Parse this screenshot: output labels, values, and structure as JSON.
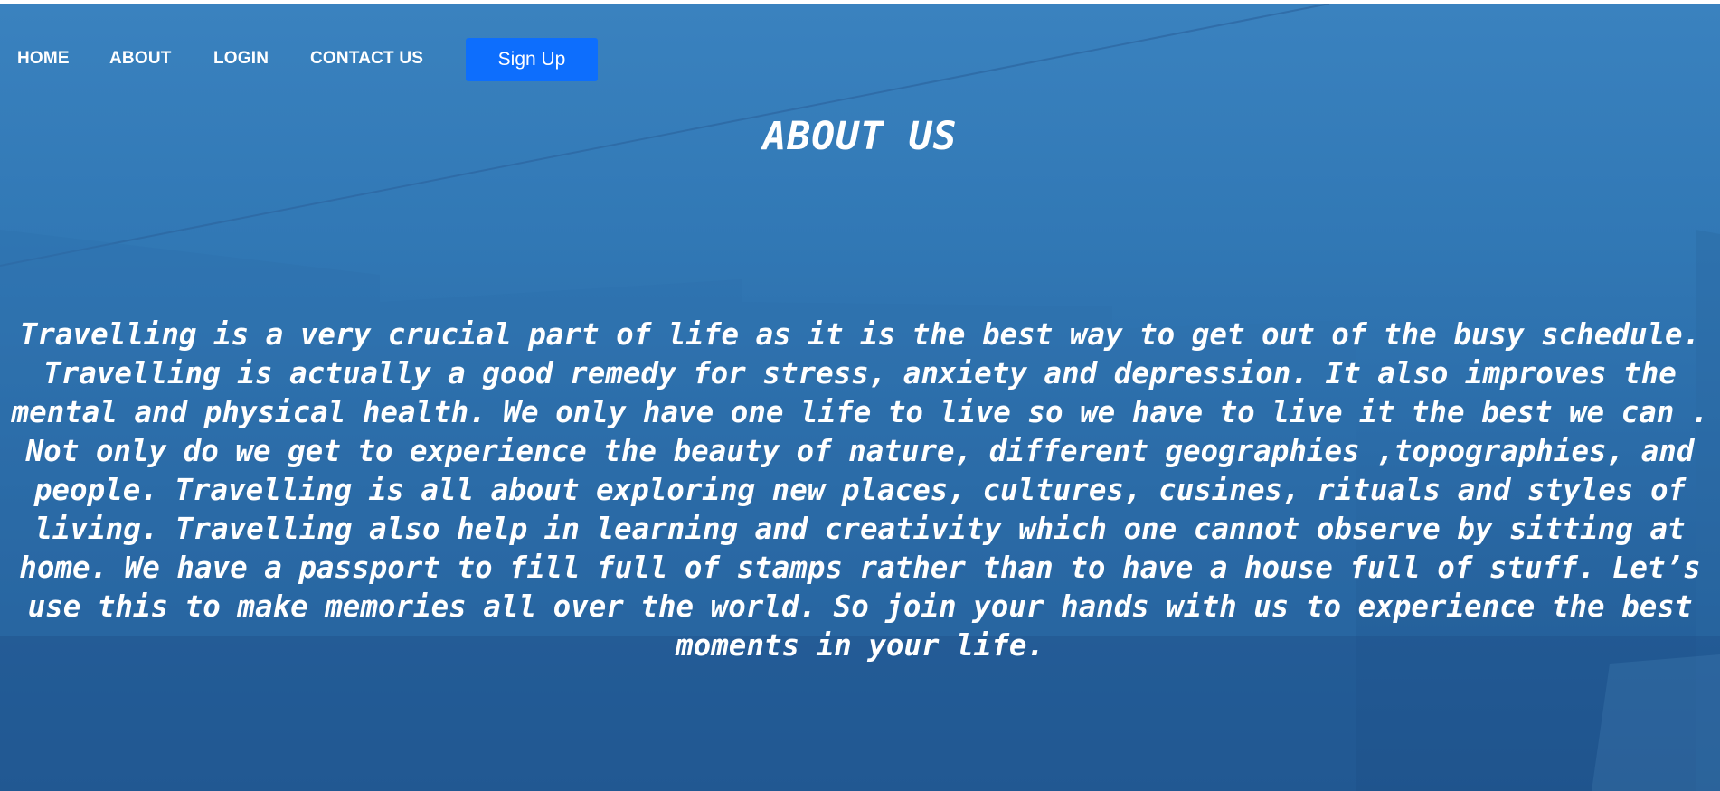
{
  "nav": {
    "home": "HOME",
    "about": "ABOUT",
    "login": "LOGIN",
    "contact": "CONTACT US",
    "signup": "Sign Up"
  },
  "colors": {
    "background": "#3178b5",
    "signup_button": "#0d6efd",
    "text": "#ffffff"
  },
  "main": {
    "title": "ABOUT US",
    "body": "Travelling is a very crucial part of life as it is the best way to get out of the busy schedule. Travelling is actually a good remedy for stress, anxiety and depression. It also improves the mental and physical health. We only have one life to live so we have to live it the best we can . Not only do we get to experience the beauty of nature, different geographies ,topographies, and people. Travelling is all about exploring new places, cultures, cusines, rituals and styles of living. Travelling also help in learning and creativity which one cannot observe by sitting at home. We have a passport to fill full of stamps rather than to have a house full of stuff. Let’s use this to make memories all over the world. So join your hands with us to experience the best moments in your life."
  }
}
